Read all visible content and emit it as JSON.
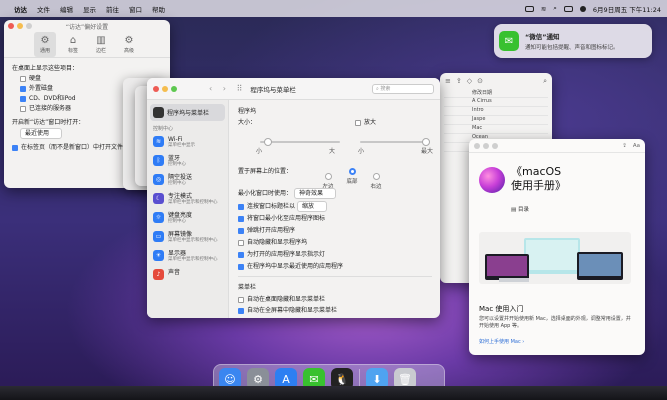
{
  "menubar": {
    "apple": "",
    "items": [
      "访达",
      "文件",
      "编辑",
      "显示",
      "前往",
      "窗口",
      "帮助"
    ],
    "datetime": "6月9日周五 下午11:24"
  },
  "finder_prefs": {
    "title": "“访达”偏好设置",
    "tabs": [
      "通用",
      "标签",
      "边栏",
      "高级"
    ],
    "heading": "在桌面上显示这些项目：",
    "checks": [
      "硬盘",
      "外置磁盘",
      "CD、DVD和iPod",
      "已连接的服务器"
    ],
    "new_window_label": "开启新“访达”窗口时打开：",
    "new_window_value": "最近使用",
    "tabs_check": "在标签页（而不是新窗口）中打开文件夹"
  },
  "sys_prefs": {
    "title": "程序坞与菜单栏",
    "search_placeholder": "搜索",
    "sidebar_header": "程序坞与菜单栏",
    "section": "控制中心",
    "items": [
      {
        "t": "Wi-Fi",
        "s": "菜单栏中显示",
        "icon": "wifi-icon",
        "color": "#2f7cf6",
        "g": "≋"
      },
      {
        "t": "蓝牙",
        "s": "控制中心",
        "icon": "bluetooth-icon",
        "color": "#2f7cf6",
        "g": "ᛒ"
      },
      {
        "t": "隔空投送",
        "s": "控制中心",
        "icon": "airdrop-icon",
        "color": "#2f7cf6",
        "g": "◎"
      },
      {
        "t": "专注模式",
        "s": "菜单栏中显示和控制中心",
        "icon": "focus-icon",
        "color": "#5a4fd0",
        "g": "☾"
      },
      {
        "t": "键盘亮度",
        "s": "控制中心",
        "icon": "keyboard-brightness-icon",
        "color": "#2f7cf6",
        "g": "☼"
      },
      {
        "t": "屏幕镜像",
        "s": "菜单栏中显示和控制中心",
        "icon": "screen-mirroring-icon",
        "color": "#2f7cf6",
        "g": "▭"
      },
      {
        "t": "显示器",
        "s": "菜单栏中显示和控制中心",
        "icon": "display-icon",
        "color": "#2f7cf6",
        "g": "☀"
      },
      {
        "t": "声音",
        "s": "",
        "icon": "sound-icon",
        "color": "#e54a3c",
        "g": "♪"
      }
    ],
    "dock_section": "程序坞",
    "size_label": "大小：",
    "size_small": "小",
    "size_large": "大",
    "mag_label": "放大",
    "mag_small": "小",
    "mag_large": "最大",
    "position_label": "置于屏幕上的位置：",
    "positions": [
      "左边",
      "底部",
      "右边"
    ],
    "minimize_label": "最小化窗口时使用：",
    "minimize_value": "神奇效果",
    "checks": [
      "连按窗口标题栏以",
      "将窗口最小化至应用程序图标",
      "弹跳打开应用程序",
      "自动隐藏和显示程序坞",
      "为打开的应用程序显示指示灯",
      "在程序坞中显示最近使用的应用程序"
    ],
    "dbl_value": "缩放",
    "menubar_section": "菜单栏",
    "menubar_checks": [
      "自动在桌面隐藏和显示菜单栏",
      "自动在全屏幕中隐藏和显示菜单栏"
    ]
  },
  "notification": {
    "title": "“微信”通知",
    "body": "通知可能包括提醒、声音和图标标记。",
    "icon": "wechat-icon"
  },
  "finder_window": {
    "rows": [
      "A Cirrus",
      "Intro",
      "Jaspe",
      "Mac",
      "Ocean",
      "Lake",
      "Tahoe",
      "Video"
    ],
    "header": "修改日期"
  },
  "tips": {
    "title": "《macOS",
    "title2": "使用手册》",
    "toc": "目录",
    "sub": "Mac 使用入门",
    "desc": "您可以设置并开始使用新 Mac，选择桌面的外观，调整常用设置，并开始使用 App 等。",
    "link": "如何上手使用 Mac ›"
  },
  "dock": [
    {
      "name": "finder-icon",
      "color": "#3a86f0",
      "g": "☺"
    },
    {
      "name": "system-preferences-icon",
      "color": "#8a8f98",
      "g": "⚙"
    },
    {
      "name": "app-store-icon",
      "color": "#2d7ff2",
      "g": "A"
    },
    {
      "name": "wechat-dock-icon",
      "color": "#38c12f",
      "g": "✉"
    },
    {
      "name": "qq-icon",
      "color": "#222",
      "g": "🐧"
    },
    {
      "name": "downloads-icon",
      "color": "#4fa3f0",
      "g": "⬇"
    },
    {
      "name": "trash-icon",
      "color": "#c9cbd0",
      "g": "🗑"
    }
  ]
}
